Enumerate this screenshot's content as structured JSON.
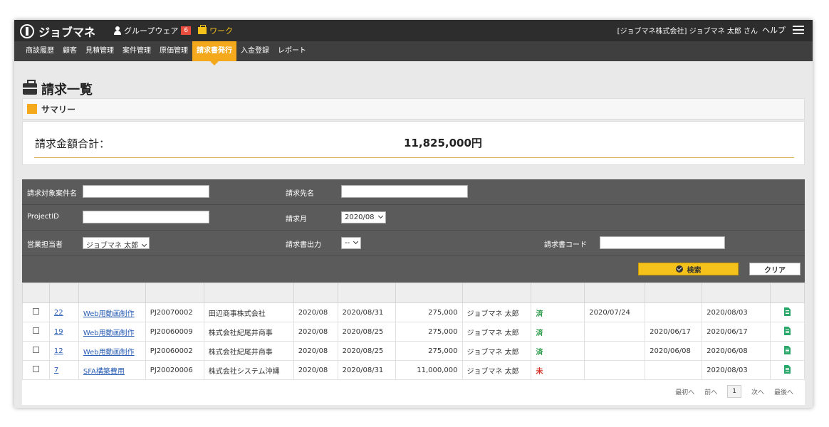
{
  "app": {
    "logo_text": "ジョブマネ",
    "groupware_label": "グループウェア",
    "groupware_count": "6",
    "work_label": "ワーク",
    "company_user": "[ジョブマネ株式会社] ジョブマネ 太郎 さん",
    "help_label": "ヘルプ"
  },
  "nav": [
    "商談履歴",
    "顧客",
    "見積管理",
    "案件管理",
    "原価管理",
    "請求書発行",
    "入金登録",
    "レポート"
  ],
  "page": {
    "title": "請求一覧"
  },
  "summary": {
    "header": "サマリー",
    "total_label": "請求金額合計：",
    "total_value": "11,825,000円"
  },
  "search": {
    "project_name_label": "請求対象案件名",
    "billing_to_label": "請求先名",
    "project_id_label": "ProjectID",
    "billing_month_label": "請求月",
    "billing_month_value": "2020/08",
    "sales_rep_label": "営業担当者",
    "sales_rep_value": "ジョブマネ 太郎",
    "invoice_output_label": "請求書出力",
    "invoice_output_value": "--",
    "invoice_code_label": "請求書コード",
    "search_button": "検索",
    "clear_button": "クリア"
  },
  "table": {
    "rows": [
      {
        "no": "22",
        "project": "Web用動画制作",
        "pid": "PJ20070002",
        "client": "田辺商事株式会社",
        "month": "2020/08",
        "date": "2020/08/31",
        "amount": "275,000",
        "rep": "ジョブマネ 太郎",
        "status": "済",
        "d1": "2020/07/24",
        "d2": "",
        "d3": "2020/08/03"
      },
      {
        "no": "19",
        "project": "Web用動画制作",
        "pid": "PJ20060009",
        "client": "株式会社紀尾井商事",
        "month": "2020/08",
        "date": "2020/08/25",
        "amount": "275,000",
        "rep": "ジョブマネ 太郎",
        "status": "済",
        "d1": "",
        "d2": "2020/06/17",
        "d3": "2020/06/17"
      },
      {
        "no": "12",
        "project": "Web用動画制作",
        "pid": "PJ20060002",
        "client": "株式会社紀尾井商事",
        "month": "2020/08",
        "date": "2020/08/25",
        "amount": "275,000",
        "rep": "ジョブマネ 太郎",
        "status": "済",
        "d1": "",
        "d2": "2020/06/08",
        "d3": "2020/06/08"
      },
      {
        "no": "7",
        "project": "SFA構築費用",
        "pid": "PJ20020006",
        "client": "株式会社システム沖縄",
        "month": "2020/08",
        "date": "2020/08/31",
        "amount": "11,000,000",
        "rep": "ジョブマネ 太郎",
        "status": "未",
        "d1": "",
        "d2": "",
        "d3": "2020/08/03"
      }
    ]
  },
  "pager": {
    "first": "最初へ",
    "prev": "前へ",
    "current": "1",
    "next": "次へ",
    "last": "最後へ"
  }
}
